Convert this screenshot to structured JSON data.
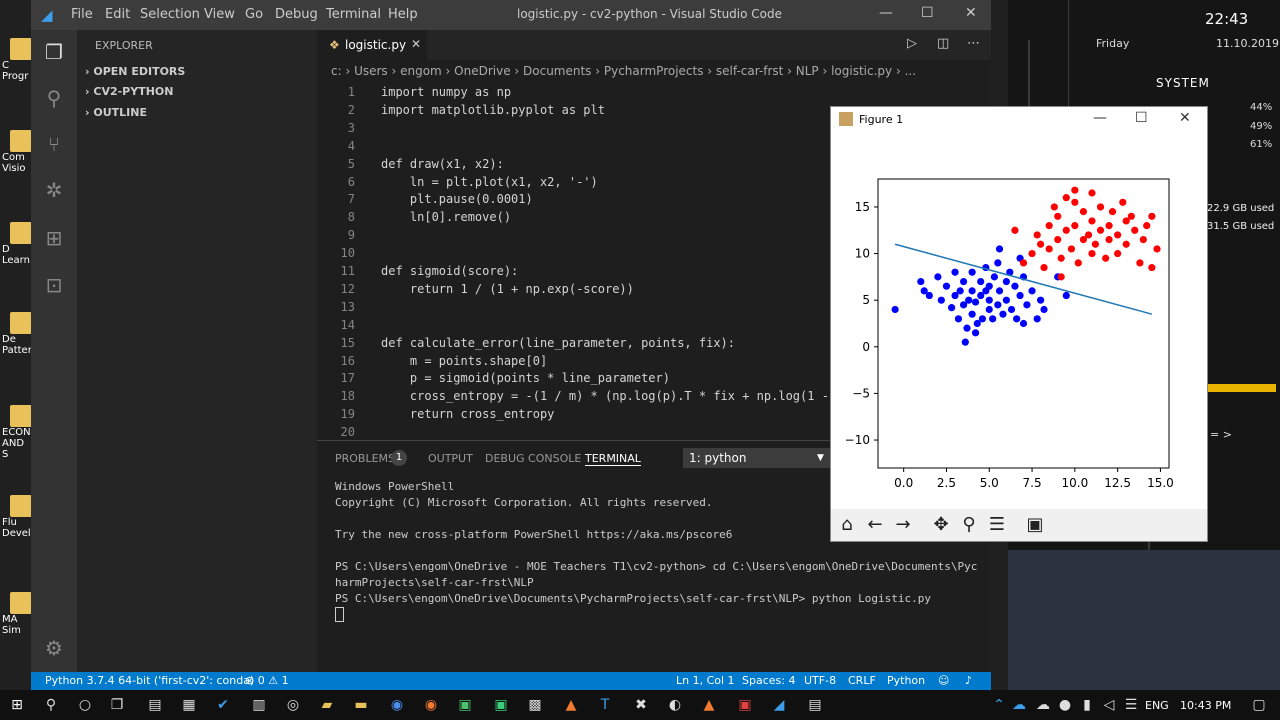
{
  "vscode": {
    "menu": [
      "File",
      "Edit",
      "Selection",
      "View",
      "Go",
      "Debug",
      "Terminal",
      "Help"
    ],
    "window_title": "logistic.py - cv2-python - Visual Studio Code",
    "sidebar": {
      "title": "EXPLORER",
      "sections": [
        "OPEN EDITORS",
        "CV2-PYTHON",
        "OUTLINE"
      ]
    },
    "tab": {
      "name": "logistic.py"
    },
    "breadcrumb": "c: › Users › engom › OneDrive › Documents › PycharmProjects › self-car-frst › NLP › logistic.py › ...",
    "code_lines": [
      {
        "n": "1",
        "text": "import numpy as np"
      },
      {
        "n": "2",
        "text": "import matplotlib.pyplot as plt"
      },
      {
        "n": "3",
        "text": ""
      },
      {
        "n": "4",
        "text": ""
      },
      {
        "n": "5",
        "text": "def draw(x1, x2):"
      },
      {
        "n": "6",
        "text": "    ln = plt.plot(x1, x2, '-')"
      },
      {
        "n": "7",
        "text": "    plt.pause(0.0001)"
      },
      {
        "n": "8",
        "text": "    ln[0].remove()"
      },
      {
        "n": "9",
        "text": ""
      },
      {
        "n": "10",
        "text": ""
      },
      {
        "n": "11",
        "text": "def sigmoid(score):"
      },
      {
        "n": "12",
        "text": "    return 1 / (1 + np.exp(-score))"
      },
      {
        "n": "13",
        "text": ""
      },
      {
        "n": "14",
        "text": ""
      },
      {
        "n": "15",
        "text": "def calculate_error(line_parameter, points, fix):"
      },
      {
        "n": "16",
        "text": "    m = points.shape[0]"
      },
      {
        "n": "17",
        "text": "    p = sigmoid(points * line_parameter)"
      },
      {
        "n": "18",
        "text": "    cross_entropy = -(1 / m) * (np.log(p).T * fix + np.log(1 -"
      },
      {
        "n": "19",
        "text": "    return cross_entropy"
      },
      {
        "n": "20",
        "text": ""
      }
    ],
    "panel": {
      "tabs": [
        "PROBLEMS",
        "OUTPUT",
        "DEBUG CONSOLE",
        "TERMINAL"
      ],
      "problems_count": "1",
      "terminal_select": "1: python",
      "terminal_lines": [
        "Windows PowerShell",
        "Copyright (C) Microsoft Corporation. All rights reserved.",
        "",
        "Try the new cross-platform PowerShell https://aka.ms/pscore6",
        "",
        "PS C:\\Users\\engom\\OneDrive - MOE Teachers T1\\cv2-python> cd C:\\Users\\engom\\OneDrive\\Documents\\Pyc",
        "harmProjects\\self-car-frst\\NLP",
        "PS C:\\Users\\engom\\OneDrive\\Documents\\PycharmProjects\\self-car-frst\\NLP> python Logistic.py"
      ]
    },
    "status": {
      "python": "Python 3.7.4 64-bit ('first-cv2': conda)",
      "errors": "0",
      "warnings": "1",
      "position": "Ln 1, Col 1",
      "spaces": "Spaces: 4",
      "encoding": "UTF-8",
      "eol": "CRLF",
      "language": "Python"
    }
  },
  "figure": {
    "title": "Figure 1",
    "toolbar": [
      "home-icon",
      "back-icon",
      "forward-icon",
      "pan-icon",
      "zoom-icon",
      "configure-icon",
      "save-icon"
    ]
  },
  "chart_data": {
    "type": "scatter",
    "xlim": [
      -1.5,
      15.5
    ],
    "ylim": [
      -13,
      18
    ],
    "xticks": [
      "0.0",
      "2.5",
      "5.0",
      "7.5",
      "10.0",
      "12.5",
      "15.0"
    ],
    "yticks": [
      "15",
      "10",
      "5",
      "0",
      "-5",
      "-10"
    ],
    "series": [
      {
        "color": "#0000ff",
        "points": [
          [
            -0.5,
            4
          ],
          [
            1,
            7
          ],
          [
            1.2,
            6
          ],
          [
            1.5,
            5.5
          ],
          [
            2,
            7.5
          ],
          [
            2.2,
            5
          ],
          [
            2.5,
            6.5
          ],
          [
            2.8,
            4.2
          ],
          [
            3,
            5.5
          ],
          [
            3,
            8
          ],
          [
            3.2,
            3
          ],
          [
            3.3,
            6
          ],
          [
            3.5,
            4.5
          ],
          [
            3.5,
            7
          ],
          [
            3.7,
            2
          ],
          [
            3.8,
            5
          ],
          [
            4,
            3.5
          ],
          [
            4,
            6
          ],
          [
            4,
            8
          ],
          [
            4.2,
            4.8
          ],
          [
            4.3,
            2.5
          ],
          [
            4.5,
            5.5
          ],
          [
            4.5,
            7
          ],
          [
            4.6,
            3
          ],
          [
            4.8,
            6
          ],
          [
            4.8,
            8.5
          ],
          [
            5,
            4
          ],
          [
            5,
            5
          ],
          [
            5,
            6.5
          ],
          [
            5.2,
            3
          ],
          [
            5.3,
            7.5
          ],
          [
            5.5,
            4.5
          ],
          [
            5.5,
            9
          ],
          [
            5.6,
            6
          ],
          [
            5.8,
            3.5
          ],
          [
            6,
            5
          ],
          [
            6,
            7
          ],
          [
            6.2,
            8
          ],
          [
            6.3,
            4
          ],
          [
            6.5,
            6.5
          ],
          [
            6.6,
            3
          ],
          [
            6.8,
            5.5
          ],
          [
            7,
            7.5
          ],
          [
            7,
            2.5
          ],
          [
            7.2,
            4.5
          ],
          [
            7.5,
            6
          ],
          [
            7.8,
            3
          ],
          [
            8,
            5
          ],
          [
            8.2,
            4
          ],
          [
            3.6,
            0.5
          ],
          [
            4.2,
            1.5
          ],
          [
            9,
            7.5
          ],
          [
            9.5,
            5.5
          ],
          [
            5.6,
            10.5
          ],
          [
            6.8,
            9.5
          ]
        ]
      },
      {
        "color": "#ff0000",
        "points": [
          [
            6.5,
            12.5
          ],
          [
            7,
            9
          ],
          [
            7.5,
            10
          ],
          [
            7.8,
            12
          ],
          [
            8,
            11
          ],
          [
            8.2,
            8.5
          ],
          [
            8.5,
            10.5
          ],
          [
            8.5,
            13
          ],
          [
            8.8,
            15
          ],
          [
            9,
            11.5
          ],
          [
            9,
            14
          ],
          [
            9.2,
            9.5
          ],
          [
            9.5,
            12.5
          ],
          [
            9.5,
            16
          ],
          [
            9.8,
            10.5
          ],
          [
            10,
            13
          ],
          [
            10,
            15.5
          ],
          [
            10.2,
            9
          ],
          [
            10.5,
            11.5
          ],
          [
            10.5,
            14.5
          ],
          [
            10.8,
            12
          ],
          [
            11,
            10
          ],
          [
            11,
            13.5
          ],
          [
            11,
            16.5
          ],
          [
            11.2,
            11
          ],
          [
            11.5,
            12.5
          ],
          [
            11.5,
            15
          ],
          [
            11.8,
            9.5
          ],
          [
            12,
            13
          ],
          [
            12,
            11.5
          ],
          [
            12.2,
            14.5
          ],
          [
            12.5,
            10
          ],
          [
            12.5,
            12
          ],
          [
            12.8,
            15.5
          ],
          [
            13,
            13.5
          ],
          [
            13,
            11
          ],
          [
            13.3,
            14
          ],
          [
            13.5,
            12.5
          ],
          [
            13.8,
            9
          ],
          [
            14,
            11.5
          ],
          [
            14.2,
            13
          ],
          [
            14.5,
            14
          ],
          [
            14.8,
            10.5
          ],
          [
            14.5,
            8.5
          ],
          [
            9.2,
            7.5
          ],
          [
            10,
            16.8
          ]
        ]
      }
    ],
    "line": {
      "color": "#1f77b4",
      "x": [
        -0.5,
        14.5
      ],
      "y": [
        11,
        3.5
      ]
    }
  },
  "desktop": {
    "widget_time": "22:43",
    "widget_day": "Friday",
    "widget_date": "11.10.2019",
    "widget_system": "SYSTEM",
    "cpu": [
      "44%",
      "49%",
      "61%"
    ],
    "mem": [
      "22.9 GB used",
      "31.5 GB used"
    ],
    "arrow": "= >",
    "icons": [
      "C Progr",
      "Com Visio",
      "D Learn",
      "De Patter",
      "ECON AND S",
      "Flu Devel",
      "MA Sim"
    ]
  },
  "taskbar": {
    "lang": "ENG",
    "time": "10:43 PM"
  }
}
